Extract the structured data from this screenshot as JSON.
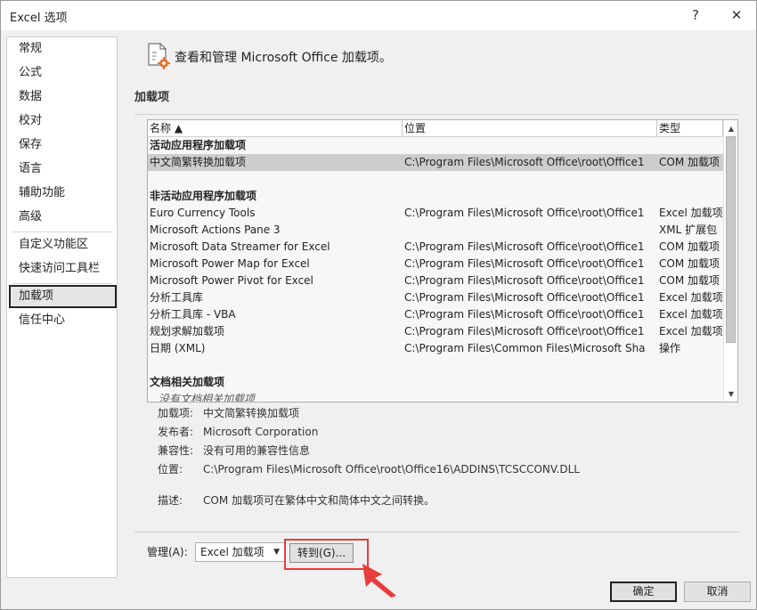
{
  "window": {
    "title": "Excel 选项",
    "help": "?",
    "close": "✕"
  },
  "nav": {
    "items": [
      "常规",
      "公式",
      "数据",
      "校对",
      "保存",
      "语言",
      "辅助功能",
      "高级",
      "自定义功能区",
      "快速访问工具栏",
      "加载项",
      "信任中心"
    ],
    "selected": "加载项"
  },
  "header": {
    "text": "查看和管理 Microsoft Office 加载项。",
    "icon": "addin-settings-icon"
  },
  "section": {
    "title": "加载项"
  },
  "list": {
    "columns": [
      "名称 ▲",
      "位置",
      "类型"
    ],
    "groups": [
      {
        "title": "活动应用程序加载项",
        "rows": [
          {
            "name": "中文简繁转换加载项",
            "location": "C:\\Program Files\\Microsoft Office\\root\\Office1",
            "type": "COM 加载项",
            "selected": true
          }
        ]
      },
      {
        "title": "非活动应用程序加载项",
        "rows": [
          {
            "name": "Euro Currency Tools",
            "location": "C:\\Program Files\\Microsoft Office\\root\\Office1",
            "type": "Excel 加载项"
          },
          {
            "name": "Microsoft Actions Pane 3",
            "location": "",
            "type": "XML 扩展包"
          },
          {
            "name": "Microsoft Data Streamer for Excel",
            "location": "C:\\Program Files\\Microsoft Office\\root\\Office1",
            "type": "COM 加载项"
          },
          {
            "name": "Microsoft Power Map for Excel",
            "location": "C:\\Program Files\\Microsoft Office\\root\\Office1",
            "type": "COM 加载项"
          },
          {
            "name": "Microsoft Power Pivot for Excel",
            "location": "C:\\Program Files\\Microsoft Office\\root\\Office1",
            "type": "COM 加载项"
          },
          {
            "name": "分析工具库",
            "location": "C:\\Program Files\\Microsoft Office\\root\\Office1",
            "type": "Excel 加载项"
          },
          {
            "name": "分析工具库 - VBA",
            "location": "C:\\Program Files\\Microsoft Office\\root\\Office1",
            "type": "Excel 加载项"
          },
          {
            "name": "规划求解加载项",
            "location": "C:\\Program Files\\Microsoft Office\\root\\Office1",
            "type": "Excel 加载项"
          },
          {
            "name": "日期 (XML)",
            "location": "C:\\Program Files\\Common Files\\Microsoft Sha",
            "type": "操作"
          }
        ]
      },
      {
        "title": "文档相关加载项",
        "rows": [
          {
            "name": "没有文档相关加载项",
            "location": "",
            "type": "",
            "italic": true
          }
        ]
      }
    ]
  },
  "details": {
    "addin": {
      "label": "加载项:",
      "value": "中文简繁转换加载项"
    },
    "publisher": {
      "label": "发布者:",
      "value": "Microsoft Corporation"
    },
    "compat": {
      "label": "兼容性:",
      "value": "没有可用的兼容性信息"
    },
    "location": {
      "label": "位置:",
      "value": "C:\\Program Files\\Microsoft Office\\root\\Office16\\ADDINS\\TCSCCONV.DLL"
    },
    "desc": {
      "label": "描述:",
      "value": "COM 加载项可在繁体中文和简体中文之间转换。"
    }
  },
  "manage": {
    "label": "管理(A):",
    "selected": "Excel 加载项",
    "go_button": "转到(G)..."
  },
  "footer": {
    "ok": "确定",
    "cancel": "取消"
  },
  "colors": {
    "highlight": "#e83d3d",
    "selected_row": "#cdcdcd"
  }
}
